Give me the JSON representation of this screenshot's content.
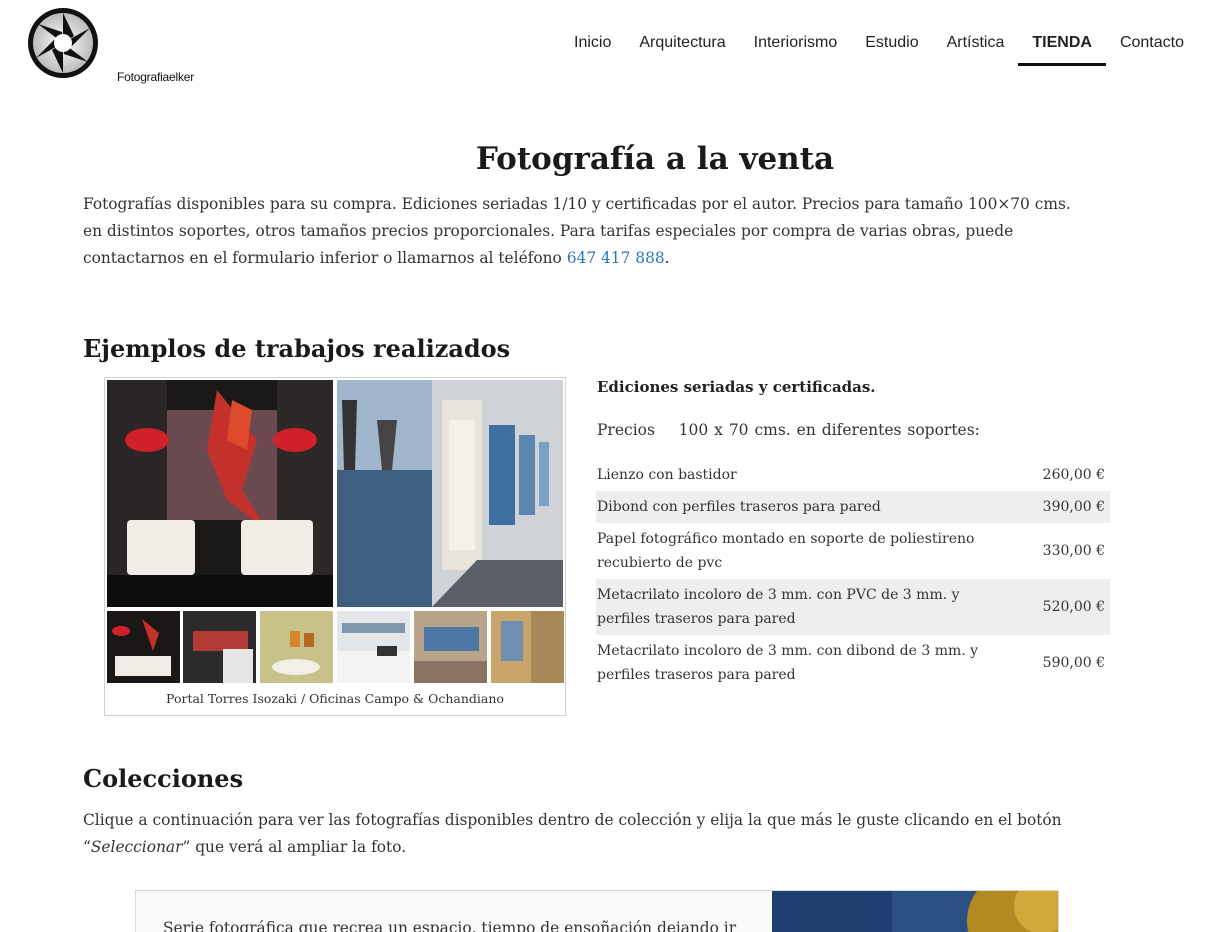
{
  "brand": {
    "name": "Fotografiaelker"
  },
  "nav": {
    "items": [
      {
        "label": "Inicio"
      },
      {
        "label": "Arquitectura"
      },
      {
        "label": "Interiorismo"
      },
      {
        "label": "Estudio"
      },
      {
        "label": "Artística"
      },
      {
        "label": "TIENDA"
      },
      {
        "label": "Contacto"
      }
    ],
    "active_index": 5
  },
  "main": {
    "title": "Fotografía a la venta",
    "intro": "Fotografías disponibles para su compra. Ediciones seriadas 1/10 y certificadas por el autor.  Precios para tamaño 100×70 cms. en distintos soportes, otros tamaños precios proporcionales. Para tarifas especiales por compra de varias obras, puede contactarnos en el formulario inferior o llamarnos al teléfono",
    "phone": "647 417 888",
    "intro_end": "."
  },
  "examples": {
    "heading": "Ejemplos de trabajos realizados",
    "caption": "Portal Torres Isozaki / Oficinas Campo & Ochandiano"
  },
  "pricing": {
    "title": "Ediciones seriadas y certificadas.",
    "subtitle": "Precios    100 x 70 cms. en diferentes soportes:",
    "rows": [
      {
        "label": "Lienzo con bastidor",
        "price": "260,00 €"
      },
      {
        "label": "Dibond con perfiles traseros para pared",
        "price": "390,00 €"
      },
      {
        "label": "Papel fotográfico montado en soporte de poliestireno recubierto de pvc",
        "price": "330,00 €"
      },
      {
        "label": "Metacrilato incoloro de 3 mm. con PVC de 3 mm. y perfiles traseros para pared",
        "price": "520,00 €"
      },
      {
        "label": "Metacrilato incoloro de 3 mm. con dibond de 3 mm. y perfiles traseros para pared",
        "price": "590,00 €"
      }
    ]
  },
  "collections": {
    "heading": "Colecciones",
    "text_before": "Clique a continuación para ver las fotografías disponibles dentro de colección y elija la que más le guste clicando en el botón “",
    "emphasis": "Seleccionar",
    "text_after": "” que verá al ampliar la foto."
  },
  "card": {
    "text": "Serie fotográfica que recrea un espacio, tiempo de ensoñación dejando ir"
  },
  "colors": {
    "link": "#2a77b9",
    "row_shade": "#eeeeee"
  }
}
